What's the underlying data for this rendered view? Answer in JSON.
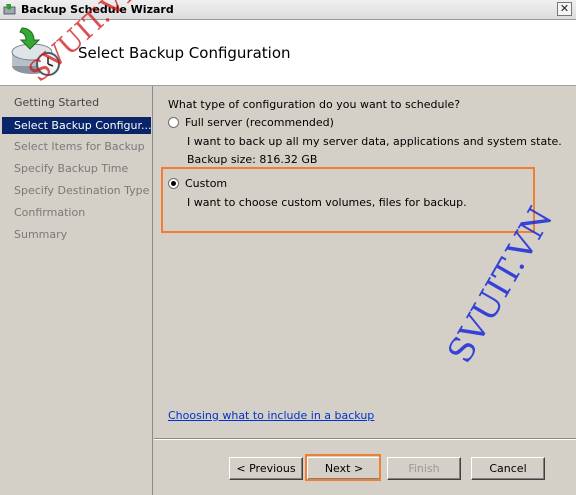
{
  "window": {
    "title": "Backup Schedule Wizard",
    "close_glyph": "✕"
  },
  "header": {
    "heading": "Select Backup Configuration",
    "icon": "backup-clock-icon"
  },
  "steps": [
    {
      "label": "Getting Started",
      "state": "done"
    },
    {
      "label": "Select Backup Configur...",
      "state": "active"
    },
    {
      "label": "Select Items for Backup",
      "state": "pending"
    },
    {
      "label": "Specify Backup Time",
      "state": "pending"
    },
    {
      "label": "Specify Destination Type",
      "state": "pending"
    },
    {
      "label": "Confirmation",
      "state": "pending"
    },
    {
      "label": "Summary",
      "state": "pending"
    }
  ],
  "content": {
    "question": "What type of configuration do you want to schedule?",
    "options": [
      {
        "label": "Full server (recommended)",
        "selected": false,
        "description": "I want to back up all my server data, applications and system state.",
        "extra": "Backup size: 816.32 GB"
      },
      {
        "label": "Custom",
        "selected": true,
        "description": "I want to choose custom volumes, files for backup."
      }
    ],
    "help_link": "Choosing what to include in a backup"
  },
  "buttons": {
    "previous": "< Previous",
    "next": "Next >",
    "finish": "Finish",
    "cancel": "Cancel"
  },
  "watermarks": [
    "SVUIT.VN",
    "SVUIT.VN"
  ],
  "colors": {
    "active_step": "#0a246a",
    "highlight": "#f08030",
    "link": "#0033cc"
  }
}
